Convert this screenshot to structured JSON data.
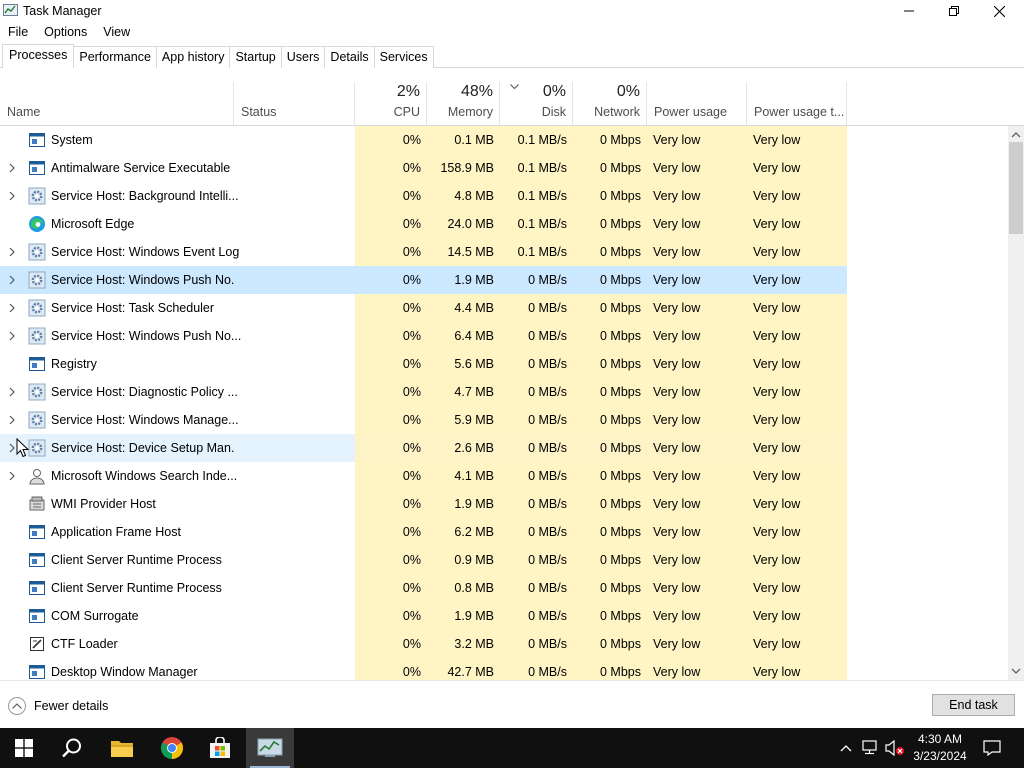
{
  "window": {
    "title": "Task Manager"
  },
  "menu": [
    "File",
    "Options",
    "View"
  ],
  "tabs": [
    "Processes",
    "Performance",
    "App history",
    "Startup",
    "Users",
    "Details",
    "Services"
  ],
  "active_tab": "Processes",
  "columns": {
    "name": "Name",
    "status": "Status",
    "cpu": {
      "pct": "2%",
      "label": "CPU"
    },
    "memory": {
      "pct": "48%",
      "label": "Memory"
    },
    "disk": {
      "pct": "0%",
      "label": "Disk"
    },
    "network": {
      "pct": "0%",
      "label": "Network"
    },
    "power": "Power usage",
    "power_trend": "Power usage t..."
  },
  "processes": [
    {
      "name": "System",
      "icon": "window-icon",
      "expandable": false,
      "cpu": "0%",
      "memory": "0.1 MB",
      "disk": "0.1 MB/s",
      "network": "0 Mbps",
      "power": "Very low",
      "power_trend": "Very low"
    },
    {
      "name": "Antimalware Service Executable",
      "icon": "window-icon",
      "expandable": true,
      "cpu": "0%",
      "memory": "158.9 MB",
      "disk": "0.1 MB/s",
      "network": "0 Mbps",
      "power": "Very low",
      "power_trend": "Very low"
    },
    {
      "name": "Service Host: Background Intelli...",
      "icon": "gear-icon",
      "expandable": true,
      "cpu": "0%",
      "memory": "4.8 MB",
      "disk": "0.1 MB/s",
      "network": "0 Mbps",
      "power": "Very low",
      "power_trend": "Very low"
    },
    {
      "name": "Microsoft Edge",
      "icon": "edge-icon",
      "expandable": false,
      "cpu": "0%",
      "memory": "24.0 MB",
      "disk": "0.1 MB/s",
      "network": "0 Mbps",
      "power": "Very low",
      "power_trend": "Very low"
    },
    {
      "name": "Service Host: Windows Event Log",
      "icon": "gear-icon",
      "expandable": true,
      "cpu": "0%",
      "memory": "14.5 MB",
      "disk": "0.1 MB/s",
      "network": "0 Mbps",
      "power": "Very low",
      "power_trend": "Very low"
    },
    {
      "name": "Service Host: Windows Push No...",
      "icon": "gear-icon",
      "expandable": true,
      "cpu": "0%",
      "memory": "1.9 MB",
      "disk": "0 MB/s",
      "network": "0 Mbps",
      "power": "Very low",
      "power_trend": "Very low"
    },
    {
      "name": "Service Host: Task Scheduler",
      "icon": "gear-icon",
      "expandable": true,
      "cpu": "0%",
      "memory": "4.4 MB",
      "disk": "0 MB/s",
      "network": "0 Mbps",
      "power": "Very low",
      "power_trend": "Very low"
    },
    {
      "name": "Service Host: Windows Push No...",
      "icon": "gear-icon",
      "expandable": true,
      "cpu": "0%",
      "memory": "6.4 MB",
      "disk": "0 MB/s",
      "network": "0 Mbps",
      "power": "Very low",
      "power_trend": "Very low"
    },
    {
      "name": "Registry",
      "icon": "window-icon",
      "expandable": false,
      "cpu": "0%",
      "memory": "5.6 MB",
      "disk": "0 MB/s",
      "network": "0 Mbps",
      "power": "Very low",
      "power_trend": "Very low"
    },
    {
      "name": "Service Host: Diagnostic Policy ...",
      "icon": "gear-icon",
      "expandable": true,
      "cpu": "0%",
      "memory": "4.7 MB",
      "disk": "0 MB/s",
      "network": "0 Mbps",
      "power": "Very low",
      "power_trend": "Very low"
    },
    {
      "name": "Service Host: Windows Manage...",
      "icon": "gear-icon",
      "expandable": true,
      "cpu": "0%",
      "memory": "5.9 MB",
      "disk": "0 MB/s",
      "network": "0 Mbps",
      "power": "Very low",
      "power_trend": "Very low"
    },
    {
      "name": "Service Host: Device Setup Man...",
      "icon": "gear-icon",
      "expandable": true,
      "cpu": "0%",
      "memory": "2.6 MB",
      "disk": "0 MB/s",
      "network": "0 Mbps",
      "power": "Very low",
      "power_trend": "Very low"
    },
    {
      "name": "Microsoft Windows Search Inde...",
      "icon": "search-person-icon",
      "expandable": true,
      "cpu": "0%",
      "memory": "4.1 MB",
      "disk": "0 MB/s",
      "network": "0 Mbps",
      "power": "Very low",
      "power_trend": "Very low"
    },
    {
      "name": "WMI Provider Host",
      "icon": "wmi-icon",
      "expandable": false,
      "cpu": "0%",
      "memory": "1.9 MB",
      "disk": "0 MB/s",
      "network": "0 Mbps",
      "power": "Very low",
      "power_trend": "Very low"
    },
    {
      "name": "Application Frame Host",
      "icon": "window-icon",
      "expandable": false,
      "cpu": "0%",
      "memory": "6.2 MB",
      "disk": "0 MB/s",
      "network": "0 Mbps",
      "power": "Very low",
      "power_trend": "Very low"
    },
    {
      "name": "Client Server Runtime Process",
      "icon": "window-icon",
      "expandable": false,
      "cpu": "0%",
      "memory": "0.9 MB",
      "disk": "0 MB/s",
      "network": "0 Mbps",
      "power": "Very low",
      "power_trend": "Very low"
    },
    {
      "name": "Client Server Runtime Process",
      "icon": "window-icon",
      "expandable": false,
      "cpu": "0%",
      "memory": "0.8 MB",
      "disk": "0 MB/s",
      "network": "0 Mbps",
      "power": "Very low",
      "power_trend": "Very low"
    },
    {
      "name": "COM Surrogate",
      "icon": "window-icon",
      "expandable": false,
      "cpu": "0%",
      "memory": "1.9 MB",
      "disk": "0 MB/s",
      "network": "0 Mbps",
      "power": "Very low",
      "power_trend": "Very low"
    },
    {
      "name": "CTF Loader",
      "icon": "ctf-icon",
      "expandable": false,
      "cpu": "0%",
      "memory": "3.2 MB",
      "disk": "0 MB/s",
      "network": "0 Mbps",
      "power": "Very low",
      "power_trend": "Very low"
    },
    {
      "name": "Desktop Window Manager",
      "icon": "window-icon",
      "expandable": false,
      "cpu": "0%",
      "memory": "42.7 MB",
      "disk": "0 MB/s",
      "network": "0 Mbps",
      "power": "Very low",
      "power_trend": "Very low"
    }
  ],
  "selected_row": 5,
  "hover_row": 11,
  "footer": {
    "fewer_details": "Fewer details",
    "end_task": "End task"
  },
  "taskbar": {
    "apps": [
      "start-icon",
      "search-icon",
      "file-explorer-icon",
      "chrome-icon",
      "store-icon",
      "task-manager-icon"
    ],
    "time": "4:30 AM",
    "date": "3/23/2024"
  },
  "colors": {
    "heat": "#fff4c4",
    "selected": "#cce8ff",
    "hover": "#e5f3ff",
    "taskbar": "#101010"
  }
}
